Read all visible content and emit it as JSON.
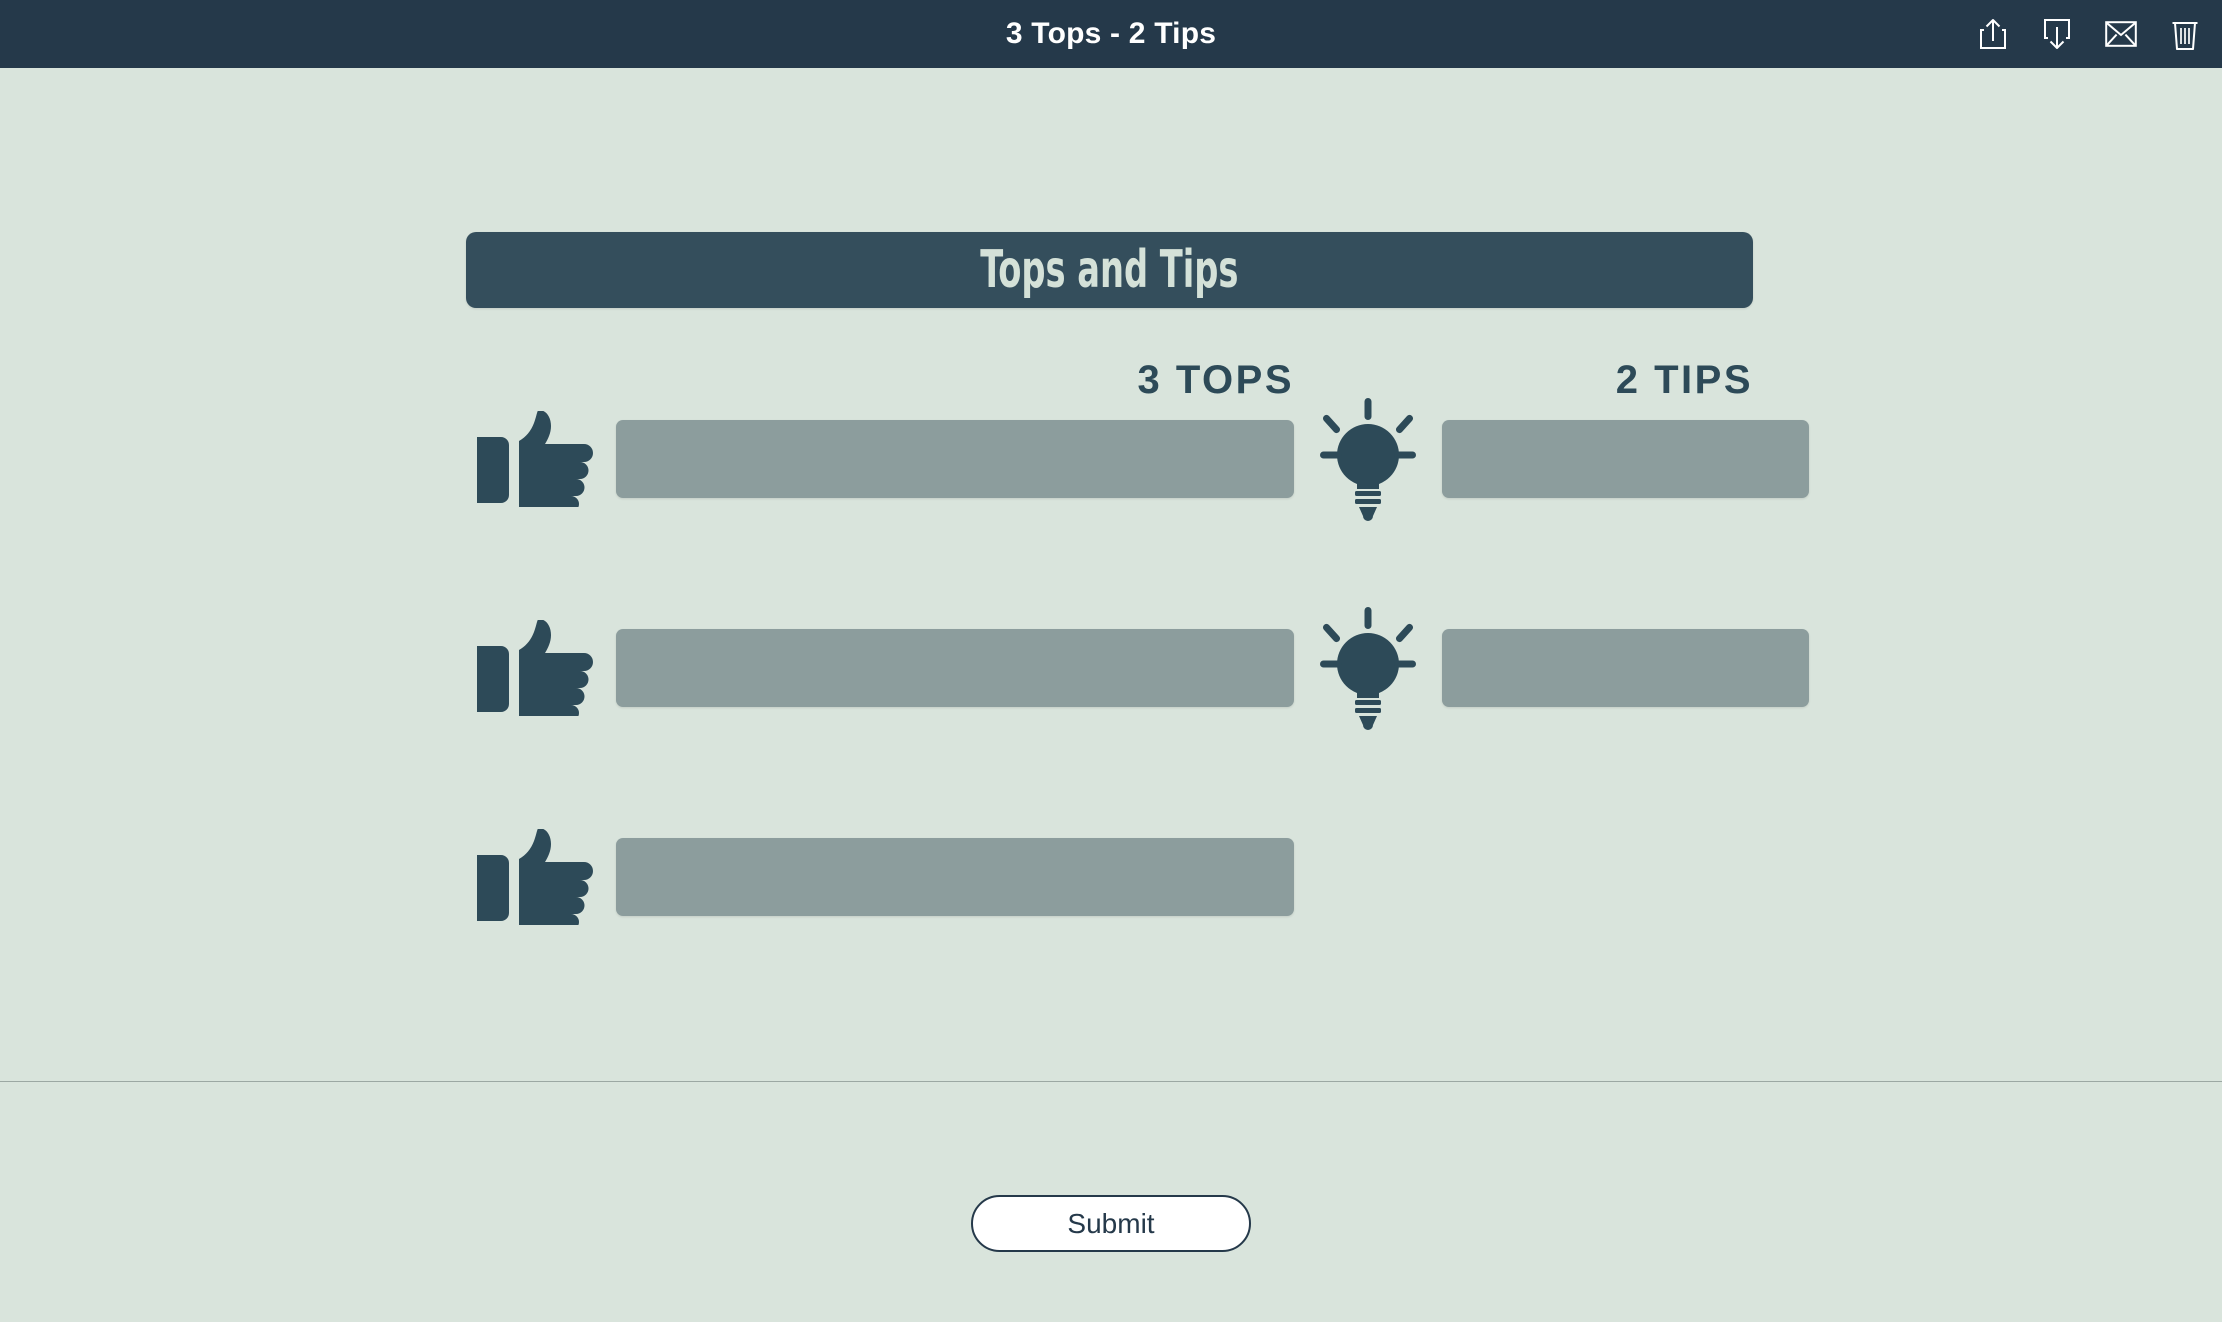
{
  "appbar": {
    "title": "3 Tops - 2 Tips",
    "actions": [
      {
        "name": "share-icon",
        "label": "Share"
      },
      {
        "name": "download-icon",
        "label": "Download"
      },
      {
        "name": "email-icon",
        "label": "Email"
      },
      {
        "name": "trash-icon",
        "label": "Delete"
      }
    ]
  },
  "banner": {
    "text": "Tops and Tips"
  },
  "columns": {
    "tops_label": "3 TOPS",
    "tips_label": "2 TIPS"
  },
  "rows": [
    {
      "tops_icon": "thumbs-up-icon",
      "tops_value": "",
      "tops_placeholder": "",
      "tips_icon": "lightbulb-icon",
      "tips_value": "",
      "tips_placeholder": "",
      "has_tips": true
    },
    {
      "tops_icon": "thumbs-up-icon",
      "tops_value": "",
      "tops_placeholder": "",
      "tips_icon": "lightbulb-icon",
      "tips_value": "",
      "tips_placeholder": "",
      "has_tips": true
    },
    {
      "tops_icon": "thumbs-up-icon",
      "tops_value": "",
      "tops_placeholder": "",
      "has_tips": false
    }
  ],
  "footer": {
    "submit_label": "Submit"
  },
  "colors": {
    "page_background": "#d9e4dc",
    "appbar_background": "#25394a",
    "banner_background": "#344e5c",
    "banner_text": "#d4e1d8",
    "icon_dark": "#2d4a58",
    "field_background": "#8c9d9d",
    "label_text": "#2d4a58",
    "divider": "#9ca8a3",
    "submit_border": "#25394a",
    "submit_background": "#ffffff"
  }
}
